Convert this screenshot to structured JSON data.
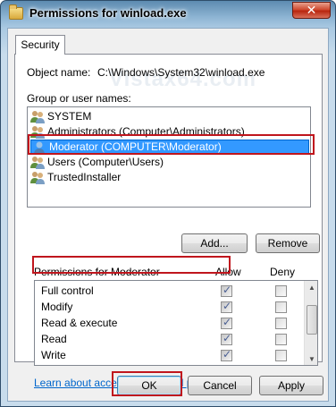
{
  "window": {
    "title": "Permissions for winload.exe",
    "close_glyph": "✕"
  },
  "tab": {
    "label": "Security"
  },
  "watermark": "Vistax64.com",
  "object": {
    "label": "Object name:",
    "value": "C:\\Windows\\System32\\winload.exe"
  },
  "groups": {
    "label": "Group or user names:",
    "items": [
      {
        "name": "SYSTEM",
        "icon": "users-icon"
      },
      {
        "name": "Administrators (Computer\\Administrators)",
        "icon": "users-icon"
      },
      {
        "name": "Moderator (COMPUTER\\Moderator)",
        "icon": "user-icon",
        "selected": true
      },
      {
        "name": "Users (Computer\\Users)",
        "icon": "users-icon"
      },
      {
        "name": "TrustedInstaller",
        "icon": "users-icon"
      }
    ]
  },
  "buttons": {
    "add": "Add...",
    "remove": "Remove",
    "ok": "OK",
    "cancel": "Cancel",
    "apply": "Apply"
  },
  "permissions": {
    "label": "Permissions for Moderator",
    "allow_label": "Allow",
    "deny_label": "Deny",
    "rows": [
      {
        "name": "Full control",
        "allow": true,
        "deny": false
      },
      {
        "name": "Modify",
        "allow": true,
        "deny": false
      },
      {
        "name": "Read & execute",
        "allow": true,
        "deny": false
      },
      {
        "name": "Read",
        "allow": true,
        "deny": false
      },
      {
        "name": "Write",
        "allow": true,
        "deny": false
      }
    ]
  },
  "link": "Learn about access control and permissions",
  "colors": {
    "selection": "#3399ff",
    "highlight_box": "#c0161d",
    "link": "#0066cc"
  }
}
